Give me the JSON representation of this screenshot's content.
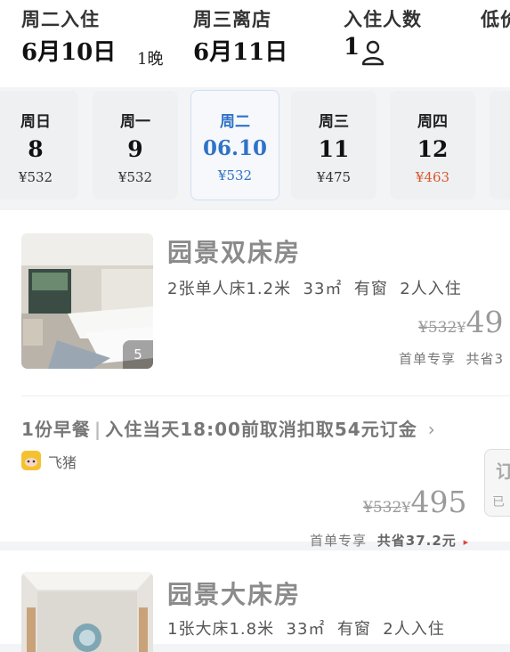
{
  "header": {
    "checkin_label": "周二入住",
    "checkin_date": "6月10日",
    "nights": "1晚",
    "checkout_label": "周三离店",
    "checkout_date": "6月11日",
    "guests_label": "入住人数",
    "guests_count": "1",
    "price_label_partial": "低价"
  },
  "date_strip": [
    {
      "weekday": "周日",
      "day": "8",
      "price": "¥532"
    },
    {
      "weekday": "周一",
      "day": "9",
      "price": "¥532"
    },
    {
      "weekday": "周二",
      "day": "06.10",
      "price": "¥532",
      "selected": true
    },
    {
      "weekday": "周三",
      "day": "11",
      "price": "¥475"
    },
    {
      "weekday": "周四",
      "day": "12",
      "price": "¥463",
      "highlight": true
    }
  ],
  "rooms": [
    {
      "name": "园景双床房",
      "specs": "2张单人床1.2米  33㎡  有窗  2人入住",
      "photo_count": "5",
      "old_price": "¥532",
      "yen": "¥",
      "price_partial": "49",
      "promo_partial": "首单专享  共省3",
      "offer": {
        "breakfast": "1份早餐",
        "policy": "入住当天18:00前取消扣取54元订金",
        "seller": "飞猪",
        "old_price": "¥532",
        "yen": "¥",
        "price": "495",
        "promo_first": "首单专享",
        "promo_save": "共省37.2元",
        "book_partial": "订",
        "book_sub_partial": "已"
      }
    },
    {
      "name": "园景大床房",
      "specs": "1张大床1.8米  33㎡  有窗  2人入住"
    }
  ],
  "colors": {
    "selected_blue": "#2f73c8",
    "low_price_orange": "#d9582c",
    "promo_arrow_red": "#e0433b",
    "seller_logo": "#f5c22f"
  }
}
